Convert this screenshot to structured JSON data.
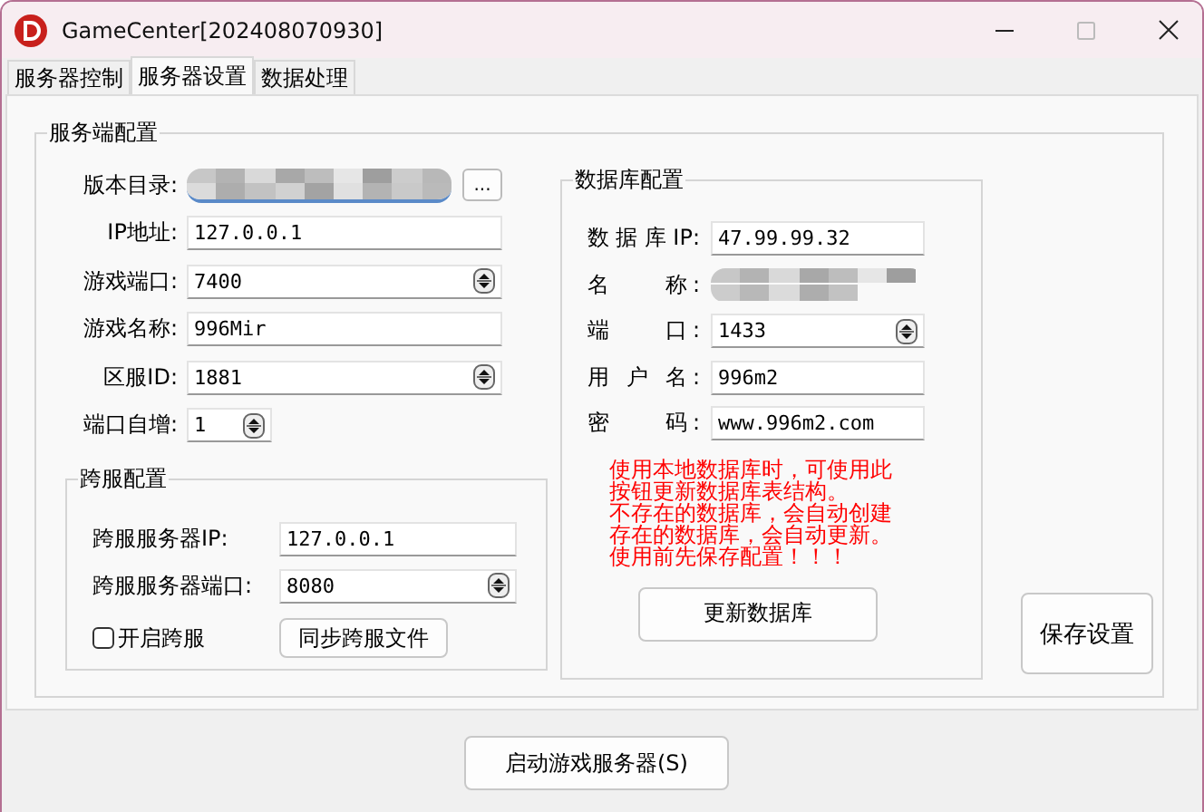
{
  "window": {
    "title": "GameCenter[202408070930]"
  },
  "tabs": [
    {
      "label": "服务器控制",
      "selected": false
    },
    {
      "label": "服务器设置",
      "selected": true
    },
    {
      "label": "数据处理",
      "selected": false
    }
  ],
  "server_group": {
    "title": "服务端配置",
    "fields": [
      {
        "label": "版本目录:",
        "kind": "redacted",
        "browse": "..."
      },
      {
        "label": "IP地址:",
        "kind": "text",
        "value": "127.0.0.1"
      },
      {
        "label": "游戏端口:",
        "kind": "spin",
        "value": "7400"
      },
      {
        "label": "游戏名称:",
        "kind": "text",
        "value": "996Mir"
      },
      {
        "label": "区服ID:",
        "kind": "spin",
        "value": "1881"
      },
      {
        "label": "端口自增:",
        "kind": "small-spin",
        "value": "1"
      }
    ],
    "cross_group": {
      "title": "跨服配置",
      "fields": [
        {
          "label": "跨服服务器IP:",
          "kind": "text",
          "value": "127.0.0.1"
        },
        {
          "label": "跨服服务器端口:",
          "kind": "spin",
          "value": "8080"
        }
      ],
      "checkbox": {
        "label": "开启跨服",
        "checked": false
      },
      "sync_button": "同步跨服文件"
    }
  },
  "db_group": {
    "title": "数据库配置",
    "fields": [
      {
        "label": "数据库IP:",
        "kind": "text",
        "value": "47.99.99.32"
      },
      {
        "label": "名    称:",
        "kind": "redacted"
      },
      {
        "label": "端    口:",
        "kind": "spin",
        "value": "1433"
      },
      {
        "label": "用 户 名:",
        "kind": "text",
        "value": "996m2"
      },
      {
        "label": "密    码:",
        "kind": "text",
        "value": "www.996m2.com"
      }
    ],
    "note": [
      "使用本地数据库时，可使用此",
      "按钮更新数据库表结构。",
      "不存在的数据库，会自动创建",
      "存在的数据库，会自动更新。",
      "使用前先保存配置！！！"
    ],
    "update_button": "更新数据库"
  },
  "save_button": "保存设置",
  "start_button": "启动游戏服务器(S)"
}
